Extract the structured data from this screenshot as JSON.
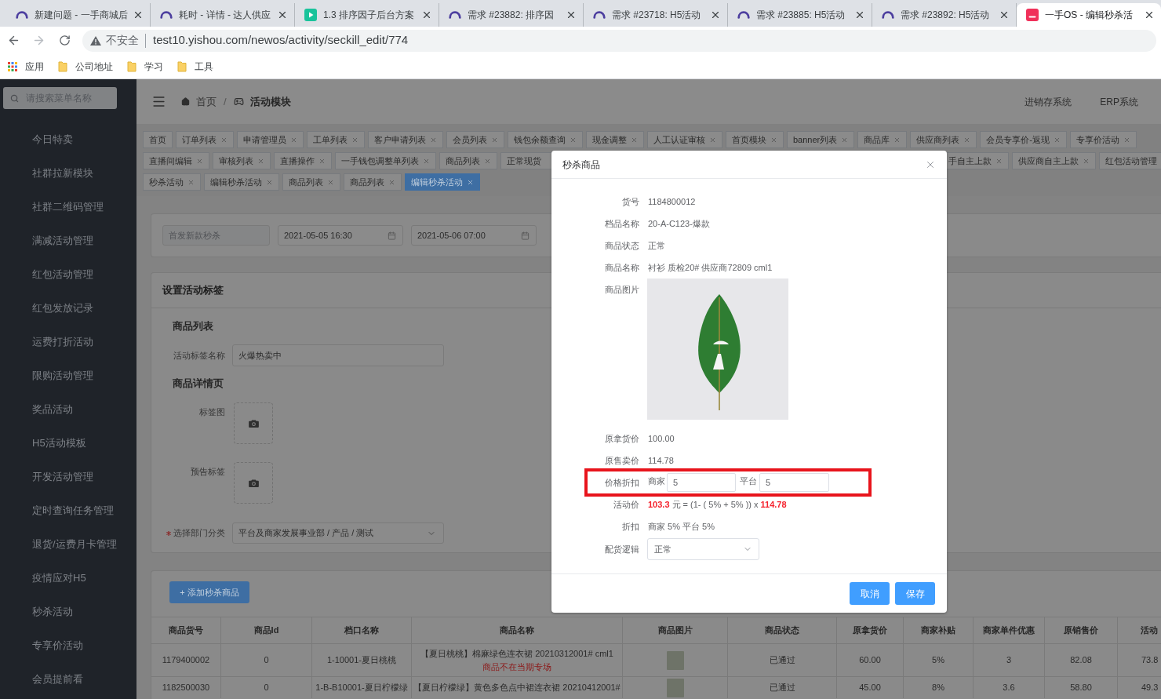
{
  "browser": {
    "tabs": [
      {
        "kind": "arch",
        "title": "新建问题 - 一手商城后",
        "selected": false
      },
      {
        "kind": "arch",
        "title": "耗时 - 详情 - 达人供应",
        "selected": false
      },
      {
        "kind": "play",
        "title": "1.3 排序因子后台方案",
        "selected": false
      },
      {
        "kind": "arch",
        "title": "需求 #23882: 排序因",
        "selected": false
      },
      {
        "kind": "arch",
        "title": "需求 #23718: H5活动",
        "selected": false
      },
      {
        "kind": "arch",
        "title": "需求 #23885: H5活动",
        "selected": false
      },
      {
        "kind": "arch",
        "title": "需求 #23892: H5活动",
        "selected": false
      },
      {
        "kind": "logo",
        "title": "一手OS - 编辑秒杀活",
        "selected": true
      }
    ],
    "navigation": {
      "forward_disabled": true
    },
    "address_bar": {
      "security": "不安全",
      "url": "test10.yishou.com/newos/activity/seckill_edit/774"
    },
    "bookmarks": [
      {
        "kind": "apps",
        "label": "应用"
      },
      {
        "kind": "folder",
        "label": "公司地址"
      },
      {
        "kind": "folder",
        "label": "学习"
      },
      {
        "kind": "folder",
        "label": "工具"
      }
    ]
  },
  "sidebar": {
    "search": {
      "placeholder": "请搜索菜单名称"
    },
    "items": [
      "今日特卖",
      "社群拉新模块",
      "社群二维码管理",
      "满减活动管理",
      "红包活动管理",
      "红包发放记录",
      "运费打折活动",
      "限购活动管理",
      "奖品活动",
      "H5活动模板",
      "开发活动管理",
      "定时查询任务管理",
      "退货/运费月卡管理",
      "疫情应对H5",
      "秒杀活动",
      "专享价活动",
      "会员提前看"
    ]
  },
  "header": {
    "breadcrumb": {
      "separator": "/",
      "items": [
        {
          "kind": "home",
          "label": "首页"
        },
        {
          "kind": "gamepad",
          "label": "活动模块"
        }
      ]
    },
    "links": [
      "进销存系统",
      "ERP系统"
    ]
  },
  "tags_view": {
    "rows": [
      {
        "tags": [
          {
            "label": "首页",
            "closable": false,
            "selected": false
          },
          {
            "label": "订单列表",
            "closable": true,
            "selected": false
          },
          {
            "label": "申请管理员",
            "closable": true,
            "selected": false
          },
          {
            "label": "工单列表",
            "closable": true,
            "selected": false
          },
          {
            "label": "客户申请列表",
            "closable": true,
            "selected": false
          },
          {
            "label": "会员列表",
            "closable": true,
            "selected": false
          },
          {
            "label": "钱包余额查询",
            "closable": true,
            "selected": false
          },
          {
            "label": "现金调整",
            "closable": true,
            "selected": false
          },
          {
            "label": "人工认证审核",
            "closable": true,
            "selected": false
          },
          {
            "label": "首页模块",
            "closable": true,
            "selected": false
          },
          {
            "label": "banner列表",
            "closable": true,
            "selected": false
          },
          {
            "label": "商品库",
            "closable": true,
            "selected": false
          },
          {
            "label": "供应商列表",
            "closable": true,
            "selected": false
          },
          {
            "label": "会员专享价-返现",
            "closable": true,
            "selected": false
          },
          {
            "label": "专享价活动",
            "closable": true,
            "selected": false
          }
        ]
      },
      {
        "tags": [
          {
            "label": "直播间编辑",
            "closable": true,
            "selected": false
          },
          {
            "label": "审核列表",
            "closable": true,
            "selected": false
          },
          {
            "label": "直播操作",
            "closable": true,
            "selected": false
          },
          {
            "label": "一手钱包调整单列表",
            "closable": true,
            "selected": false
          },
          {
            "label": "商品列表",
            "closable": true,
            "selected": false
          },
          {
            "label": "正常现货",
            "selected": false
          }
        ],
        "tags_right": [
          {
            "label": "手自主上款",
            "closable": true,
            "selected": false
          },
          {
            "label": "供应商自主上款",
            "closable": true,
            "selected": false
          },
          {
            "label": "红包活动管理",
            "selected": false
          }
        ]
      },
      {
        "tags": [
          {
            "label": "秒杀活动",
            "closable": true,
            "selected": false
          },
          {
            "label": "编辑秒杀活动",
            "closable": true,
            "selected": false
          },
          {
            "label": "商品列表",
            "closable": true,
            "selected": false
          },
          {
            "label": "商品列表",
            "closable": true,
            "selected": false
          },
          {
            "label": "编辑秒杀活动",
            "closable": true,
            "selected": true
          }
        ]
      }
    ]
  },
  "filters": [
    {
      "kind": "text",
      "value": "首发新款秒杀",
      "disabled": true
    },
    {
      "kind": "date",
      "value": "2021-05-05 16:30",
      "disabled": false
    },
    {
      "kind": "date",
      "value": "2021-05-06 07:00",
      "disabled": false
    }
  ],
  "tag_settings": {
    "title": "设置活动标签",
    "list_heading": "商品列表",
    "tag_name": {
      "label": "活动标签名称",
      "value": "火爆热卖中"
    },
    "detail_heading": "商品详情页",
    "uploads": [
      {
        "label": "标签图"
      },
      {
        "label": "预告标签"
      }
    ],
    "department": {
      "label": "选择部门分类",
      "required": true,
      "value": "平台及商家发展事业部 / 产品 / 测试"
    }
  },
  "products": {
    "add_button": "+ 添加秒杀商品",
    "columns": [
      "商品货号",
      "商品Id",
      "档口名称",
      "商品名称",
      "商品图片",
      "商品状态",
      "原拿货价",
      "商家补贴",
      "商家单件优惠",
      "原销售价",
      "活动"
    ],
    "rows": [
      {
        "sku": "1179400002",
        "product_id": "0",
        "stall": "1-10001-夏日桃桃",
        "name": "【夏日桃桃】棉麻绿色连衣裙 20210312001# cml1",
        "note": "商品不在当期专场",
        "status": "已通过",
        "cost_price": "60.00",
        "subsidy": "5%",
        "unit_discount": "3",
        "sale_price": "82.08",
        "column_11": "73.8"
      },
      {
        "sku": "1182500030",
        "product_id": "0",
        "stall": "1-B-B10001-夏日柠檬绿",
        "name": "【夏日柠檬绿】黄色多色点中裙连衣裙 20210412001#",
        "status": "已通过",
        "cost_price": "45.00",
        "subsidy": "8%",
        "unit_discount": "3.6",
        "sale_price": "58.80",
        "column_11": "49.3"
      }
    ]
  },
  "dialog": {
    "title": "秒杀商品",
    "fields": [
      {
        "kind": "text",
        "label": "货号",
        "value": "1184800012"
      },
      {
        "kind": "text",
        "label": "档品名称",
        "value": "20-A-C123-爆款"
      },
      {
        "kind": "text",
        "label": "商品状态",
        "value": "正常"
      },
      {
        "kind": "text",
        "label": "商品名称",
        "value": "衬衫 质检20# 供应商72809 cml1"
      },
      {
        "kind": "image",
        "label": "商品图片"
      },
      {
        "kind": "text",
        "label": "原拿货价",
        "value": "100.00"
      },
      {
        "kind": "text",
        "label": "原售卖价",
        "value": "114.78"
      },
      {
        "kind": "discount",
        "label": "价格折扣",
        "highlighted": true,
        "merchant": {
          "label": "商家",
          "value": "5"
        },
        "platform": {
          "label": "平台",
          "value": "5"
        }
      },
      {
        "kind": "price",
        "label": "活动价",
        "price": "103.3",
        "formula": "元 = (1- ( 5% + 5% )) x",
        "base": "114.78"
      },
      {
        "kind": "text",
        "label": "折扣",
        "value": "商家 5% 平台 5%"
      },
      {
        "kind": "select",
        "label": "配货逻辑",
        "value": "正常"
      }
    ],
    "buttons": [
      "取消",
      "保存"
    ]
  }
}
